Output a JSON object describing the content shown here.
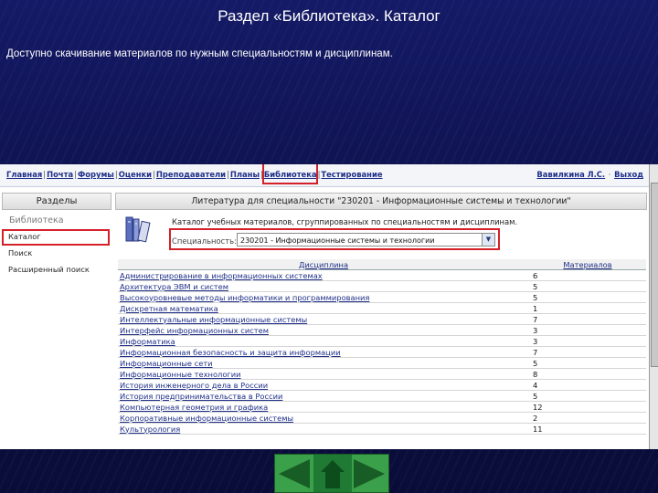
{
  "slide": {
    "title": "Раздел «Библиотека». Каталог",
    "description": "Доступно скачивание материалов по нужным специальностям и дисциплинам."
  },
  "topnav": {
    "items": [
      "Главная",
      "Почта",
      "Форумы",
      "Оценки",
      "Преподаватели",
      "Планы",
      "Библиотека",
      "Тестирование"
    ],
    "user": "Вавилкина Л.С.",
    "logout": "Выход",
    "highlighted": "Библиотека"
  },
  "sidebar": {
    "header": "Разделы",
    "section": "Библиотека",
    "items": [
      "Каталог",
      "Поиск",
      "Расширенный поиск"
    ],
    "selected": "Каталог"
  },
  "main": {
    "header": "Литература для специальности \"230201 - Информационные системы и технологии\"",
    "catalog_desc": "Каталог учебных материалов, сгруппированных по специальностям и дисциплинам.",
    "spec_label": "Специальность:",
    "spec_value": "230201 - Информационные системы и технологии",
    "table": {
      "headers": [
        "Дисциплина",
        "Материалов"
      ],
      "rows": [
        {
          "name": "Администрирование в информационных системах",
          "count": "6"
        },
        {
          "name": "Архитектура ЭВМ и систем",
          "count": "5"
        },
        {
          "name": "Высокоуровневые методы информатики и программирования",
          "count": "5"
        },
        {
          "name": "Дискретная математика",
          "count": "1"
        },
        {
          "name": "Интеллектуальные информационные системы",
          "count": "7"
        },
        {
          "name": "Интерфейс информационных систем",
          "count": "3"
        },
        {
          "name": "Информатика",
          "count": "3"
        },
        {
          "name": "Информационная безопасность и защита информации",
          "count": "7"
        },
        {
          "name": "Информационные сети",
          "count": "5"
        },
        {
          "name": "Информационные технологии",
          "count": "8"
        },
        {
          "name": "История инженерного дела в России",
          "count": "4"
        },
        {
          "name": "История предпринимательства в России",
          "count": "5"
        },
        {
          "name": "Компьютерная геометрия и графика",
          "count": "12"
        },
        {
          "name": "Корпоративные информационные системы",
          "count": "2"
        },
        {
          "name": "Культурология",
          "count": "11"
        }
      ]
    }
  },
  "footer": {
    "icons": [
      "arrow-left-icon",
      "home-icon",
      "arrow-right-icon"
    ],
    "accent": "#3aa04a"
  },
  "colors": {
    "background": "#0d1046",
    "highlight": "#d42028",
    "link": "#1f2f88"
  }
}
